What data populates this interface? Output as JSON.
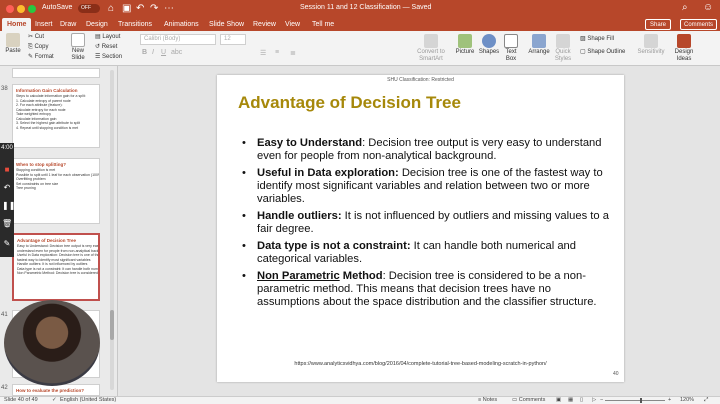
{
  "titlebar": {
    "autosave_label": "AutoSave",
    "autosave_state": "OFF",
    "doc_title": "Session 11 and 12 Classification — Saved",
    "search_icon": "search-icon",
    "feedback_icon": "smiley-icon"
  },
  "tabs": [
    "Home",
    "Insert",
    "Draw",
    "Design",
    "Transitions",
    "Animations",
    "Slide Show",
    "Review",
    "View",
    "Tell me"
  ],
  "share_label": "Share",
  "comments_label": "Comments",
  "ribbon": {
    "paste": "Paste",
    "cut": "Cut",
    "copy": "Copy",
    "format": "Format",
    "new_slide": "New Slide",
    "layout": "Layout",
    "reset": "Reset",
    "section": "Section",
    "font_placeholder": "Calibri (Body)",
    "size_placeholder": "12",
    "convert": "Convert to SmartArt",
    "picture": "Picture",
    "shapes": "Shapes",
    "textbox": "Text Box",
    "arrange": "Arrange",
    "quick_styles": "Quick Styles",
    "shape_fill": "Shape Fill",
    "shape_outline": "Shape Outline",
    "sensitivity": "Sensitivity",
    "design_ideas": "Design Ideas"
  },
  "thumbnails": [
    {
      "num": "38",
      "title": "Information Gain Calculation",
      "lines": [
        "Steps to calculate information gain for a split:",
        "1. Calculate entropy of parent node",
        "2. For each attribute (feature):",
        "Calculate entropy for each node",
        "Take weighted entropy",
        "Calculate information gain",
        "3. Select the highest gain attribute to split",
        "4. Repeat until stopping condition is met"
      ]
    },
    {
      "num": "39",
      "title": "When to stop splitting?",
      "lines": [
        "Stopping condition is met",
        "Possible to split until 1 leaf for each observation (100% accuracy!)",
        "Overfitting problem",
        "Set constraints on tree size",
        "Tree pruning"
      ]
    },
    {
      "num": "40",
      "title": "Advantage of Decision Tree",
      "lines": [
        "Easy to Understand: Decision tree output is very easy to",
        "understand even for people from non-analytical background.",
        "Useful in Data exploration: Decision tree is one of the",
        "fastest way to identify most significant variables",
        "Handle outliers: It is not influenced by outliers",
        "Data type is not a constraint: It can handle both numerical",
        "Non Parametric Method: Decision tree is considered"
      ]
    },
    {
      "num": "41",
      "title": "",
      "lines": []
    },
    {
      "num": "42",
      "title": "How to evaluate the prediction?",
      "lines": []
    }
  ],
  "recorder": {
    "time": "4:00"
  },
  "slide": {
    "classification": "SHU Classification: Restricted",
    "title": "Advantage of Decision Tree",
    "bullets": [
      {
        "term": "Easy to Understand",
        "text": ": Decision tree output is very easy to understand even for people from non-analytical background."
      },
      {
        "term": "Useful in Data exploration:",
        "text": " Decision tree is one of the fastest way to identify most significant variables and relation between two or more variables."
      },
      {
        "term": "Handle outliers:",
        "text": " It is not influenced by outliers and missing values to a fair degree."
      },
      {
        "term": "Data type is not a constraint:",
        "text": " It can handle both numerical and categorical variables."
      },
      {
        "term": "Non Parametric",
        "term2": " Method",
        "text": ": Decision tree is considered to be a non-parametric method. This means that decision trees have no assumptions about the space distribution and the classifier structure."
      }
    ],
    "url": "https://www.analyticsvidhya.com/blog/2016/04/complete-tutorial-tree-based-modeling-scratch-in-python/",
    "page_number": "40"
  },
  "status": {
    "slide_pos": "Slide 40 of 49",
    "language": "English (United States)",
    "notes": "Notes",
    "comments": "Comments",
    "zoom": "120%"
  }
}
